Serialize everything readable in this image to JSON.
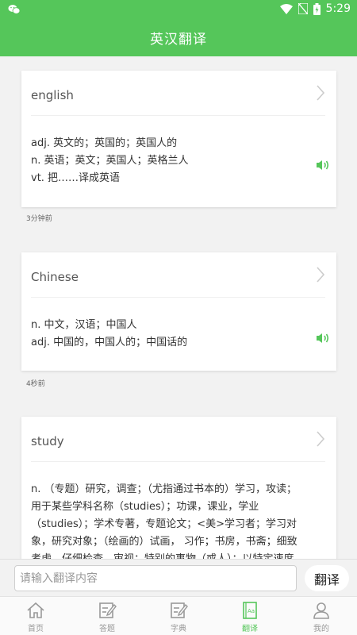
{
  "status": {
    "time": "5:29"
  },
  "header": {
    "title": "英汉翻译"
  },
  "entries": [
    {
      "word": "english",
      "defs": [
        "adj. 英文的；英国的；英国人的",
        "n. 英语；英文；英国人；英格兰人",
        "vt. 把……译成英语"
      ],
      "time": "3分钟前"
    },
    {
      "word": "Chinese",
      "defs": [
        "n. 中文，汉语；中国人",
        "adj. 中国的，中国人的；中国话的"
      ],
      "time": "4秒前"
    },
    {
      "word": "study",
      "defs": [
        "n. （专题）研究，调查；（尤指通过书本的）学习，攻读；",
        "用于某些学科名称（studies）；功课，课业，学业",
        "（studies）；学术专著，专题论文；<美>学习者；学习对",
        "象，研究对象；（绘画的）试画， 习作；书房，书斋；细致",
        "考虑，仔细检查，审视；特别的事物（或人）；以特定速度"
      ]
    }
  ],
  "input": {
    "placeholder": "请输入翻译内容",
    "button": "翻译"
  },
  "tabs": [
    {
      "label": "首页",
      "icon": "home-icon"
    },
    {
      "label": "答题",
      "icon": "edit-icon"
    },
    {
      "label": "字典",
      "icon": "edit-icon"
    },
    {
      "label": "翻译",
      "icon": "dictionary-icon",
      "active": true
    },
    {
      "label": "我的",
      "icon": "person-icon"
    }
  ],
  "colors": {
    "primary": "#55c65a",
    "background": "#f2f2f2"
  }
}
